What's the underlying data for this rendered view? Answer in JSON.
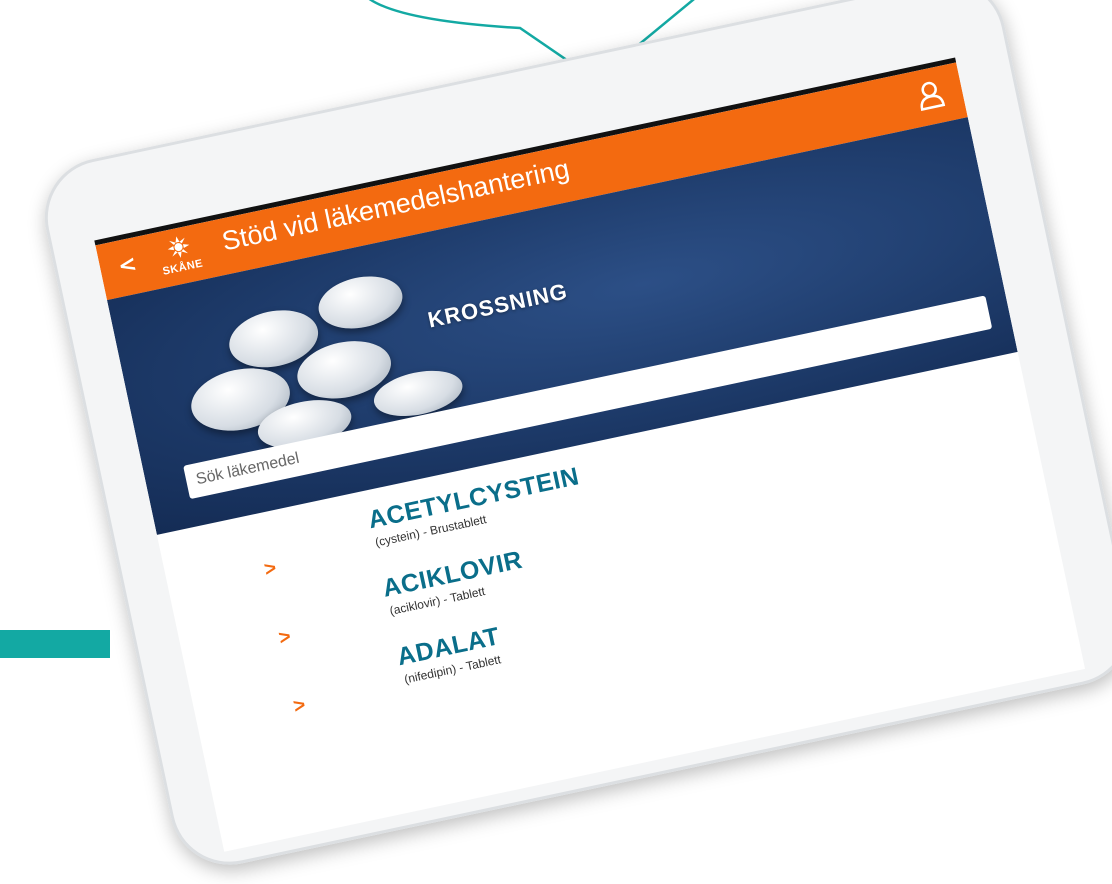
{
  "app": {
    "title": "Stöd vid läkemedelshantering",
    "logo_text": "SKÅNE"
  },
  "hero": {
    "title": "KROSSNING"
  },
  "search": {
    "placeholder": "Sök läkemedel"
  },
  "list": {
    "items": [
      {
        "name": "ACETYLCYSTEIN",
        "subtitle": "(cystein) - Brustablett"
      },
      {
        "name": "ACIKLOVIR",
        "subtitle": "(aciklovir) - Tablett"
      },
      {
        "name": "ADALAT",
        "subtitle": "(nifedipin) - Tablett"
      }
    ]
  },
  "colors": {
    "header": "#f36a10",
    "accent_teal": "#13a9a3",
    "item_name": "#0a6e8a"
  },
  "icons": {
    "back": "chevron-left-icon",
    "user": "user-icon",
    "row_chevron": "chevron-right-icon"
  }
}
